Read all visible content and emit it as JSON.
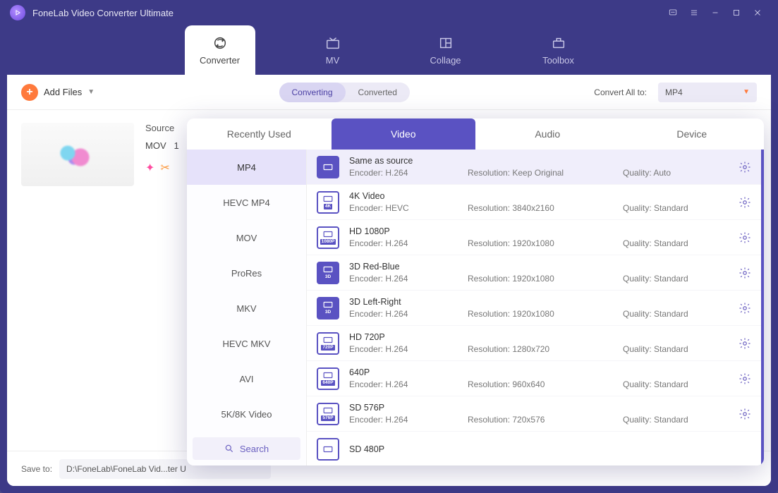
{
  "app": {
    "title": "FoneLab Video Converter Ultimate"
  },
  "nav": {
    "converter": "Converter",
    "mv": "MV",
    "collage": "Collage",
    "toolbox": "Toolbox"
  },
  "toolbar": {
    "add_files": "Add Files",
    "converting": "Converting",
    "converted": "Converted",
    "convert_all_label": "Convert All to:",
    "convert_all_value": "MP4"
  },
  "file": {
    "source_label": "Source",
    "format": "MOV",
    "info_trunc": "1"
  },
  "bottom": {
    "save_to_label": "Save to:",
    "path": "D:\\FoneLab\\FoneLab Vid...ter U"
  },
  "popover": {
    "tabs": {
      "recent": "Recently Used",
      "video": "Video",
      "audio": "Audio",
      "device": "Device"
    },
    "formats": [
      "MP4",
      "HEVC MP4",
      "MOV",
      "ProRes",
      "MKV",
      "HEVC MKV",
      "AVI",
      "5K/8K Video"
    ],
    "search": "Search",
    "presets": [
      {
        "name": "Same as source",
        "tag": "",
        "encoder": "H.264",
        "resolution": "Keep Original",
        "quality": "Auto",
        "solid": true
      },
      {
        "name": "4K Video",
        "tag": "4K",
        "encoder": "HEVC",
        "resolution": "3840x2160",
        "quality": "Standard"
      },
      {
        "name": "HD 1080P",
        "tag": "1080P",
        "encoder": "H.264",
        "resolution": "1920x1080",
        "quality": "Standard"
      },
      {
        "name": "3D Red-Blue",
        "tag": "3D",
        "encoder": "H.264",
        "resolution": "1920x1080",
        "quality": "Standard",
        "solid": true
      },
      {
        "name": "3D Left-Right",
        "tag": "3D",
        "encoder": "H.264",
        "resolution": "1920x1080",
        "quality": "Standard",
        "solid": true
      },
      {
        "name": "HD 720P",
        "tag": "720P",
        "encoder": "H.264",
        "resolution": "1280x720",
        "quality": "Standard"
      },
      {
        "name": "640P",
        "tag": "640P",
        "encoder": "H.264",
        "resolution": "960x640",
        "quality": "Standard"
      },
      {
        "name": "SD 576P",
        "tag": "576P",
        "encoder": "H.264",
        "resolution": "720x576",
        "quality": "Standard"
      },
      {
        "name": "SD 480P",
        "tag": "",
        "encoder": "",
        "resolution": "",
        "quality": ""
      }
    ],
    "labels": {
      "encoder": "Encoder: ",
      "resolution": "Resolution: ",
      "quality": "Quality: "
    }
  }
}
